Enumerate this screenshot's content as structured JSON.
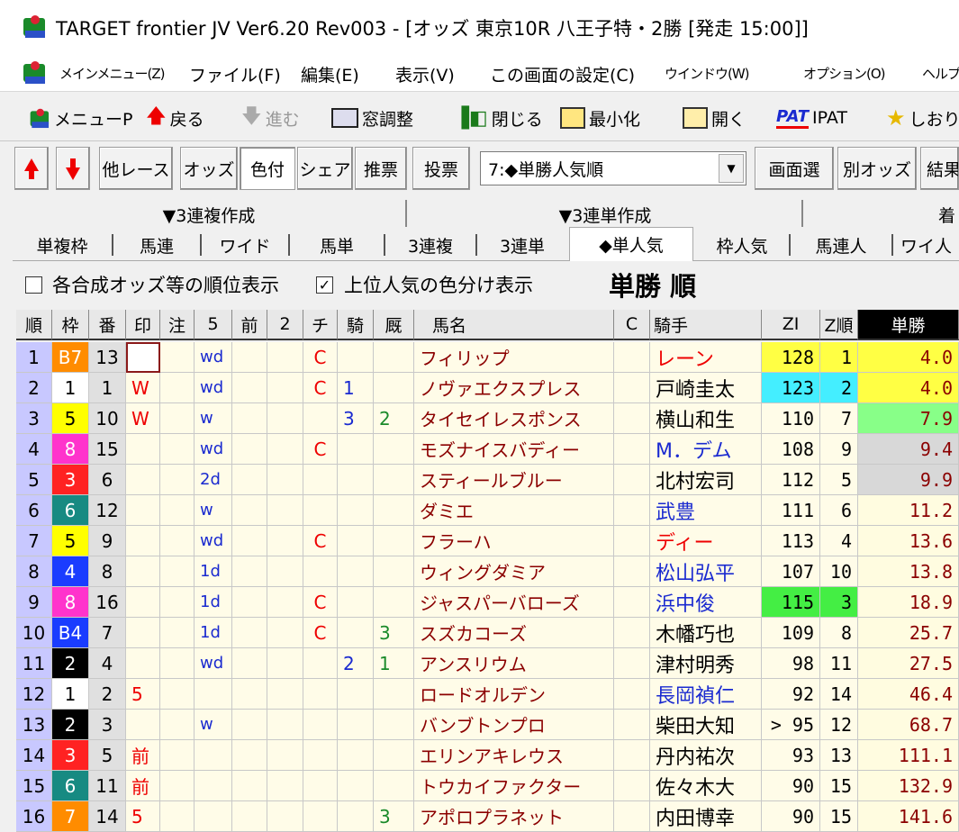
{
  "window": {
    "title": "TARGET frontier JV  Ver6.20  Rev003 - [オッズ 東京10R 八王子特・2勝  [発走 15:00]]"
  },
  "menu": {
    "main": "メインメニュー(Z)",
    "file": "ファイル(F)",
    "edit": "編集(E)",
    "view": "表示(V)",
    "screen_settings": "この画面の設定(C)",
    "window": "ウインドウ(W)",
    "option": "オプション(O)",
    "help": "ヘルプ"
  },
  "toolbar": {
    "menu_p": "メニューP",
    "back": "戻る",
    "forward": "進む",
    "window_adjust": "窓調整",
    "close": "閉じる",
    "minimize": "最小化",
    "open": "開く",
    "ipat_icon": "PAT",
    "ipat": "IPAT",
    "bookmark": "しおり"
  },
  "toolbar2": {
    "other_race": "他レース",
    "odds": "オッズ",
    "color": "色付",
    "share": "シェア",
    "recommend": "推票",
    "vote": "投票",
    "select_value": "7:◆単勝人気順",
    "screen_select": "画面選",
    "other_odds": "別オッズ",
    "result": "結果"
  },
  "tab_groups": {
    "trio_make": "▼3連複作成",
    "trifecta_make": "▼3連単作成",
    "extra": "着"
  },
  "tabs": [
    "単複枠",
    "馬連",
    "ワイド",
    "馬単",
    "3連複",
    "3連単",
    "◆単人気",
    "枠人気",
    "馬連人",
    "ワイ人"
  ],
  "options": {
    "rank_display": "各合成オッズ等の順位表示",
    "rank_display_checked": false,
    "color_display": "上位人気の色分け表示",
    "color_display_checked": true,
    "check_mark": "✓"
  },
  "view_title": "単勝 順",
  "columns": [
    "順",
    "枠",
    "番",
    "印",
    "注",
    "5",
    "前",
    "2",
    "チ",
    "騎",
    "厩",
    "馬名",
    "C",
    "騎手",
    "ZI",
    "Z順",
    "単勝"
  ],
  "colors": {
    "gate1": "#ffffff",
    "gate2": "#000000",
    "gate3": "#ff2222",
    "gate4": "#1a3cff",
    "gate5": "#ffff00",
    "gate6": "#178a82",
    "gate7": "#ff8c00",
    "gate8": "#ff33cc",
    "rank_bg": "#c8c8ff",
    "yellow": "#ffff44",
    "cyan": "#44eeff",
    "green": "#44ee44",
    "odds_green": "#88ff88",
    "odds_gray": "#d8d8d8",
    "odds_bg": "#fffce0",
    "row_bg": "#fffce8"
  },
  "rows": [
    {
      "rank": "1",
      "gate": "B7",
      "num": "13",
      "mark": "",
      "note": "",
      "five": "wd",
      "mae": "",
      "two": "",
      "chi": "C",
      "ki": "",
      "kyu": "",
      "name": "フィリップ",
      "c": "",
      "jockey": "レーン",
      "jockey_color": "red",
      "zi": "128",
      "zi_bg": "yellow",
      "zrank": "1",
      "zrank_bg": "yellow",
      "odds": "4.0",
      "odds_bg": "yellow",
      "gatecolor": "7",
      "gate_box": true
    },
    {
      "rank": "2",
      "gate": "1",
      "num": "1",
      "mark": "W",
      "note": "",
      "five": "wd",
      "mae": "",
      "two": "",
      "chi": "C",
      "ki": "1",
      "kyu": "",
      "name": "ノヴァエクスプレス",
      "c": "",
      "jockey": "戸崎圭太",
      "jockey_color": "black",
      "zi": "123",
      "zi_bg": "cyan",
      "zrank": "2",
      "zrank_bg": "cyan",
      "odds": "4.0",
      "odds_bg": "yellow",
      "gatecolor": "1"
    },
    {
      "rank": "3",
      "gate": "5",
      "num": "10",
      "mark": "W",
      "note": "",
      "five": "w",
      "mae": "",
      "two": "",
      "chi": "",
      "ki": "3",
      "kyu": "2",
      "name": "タイセイレスポンス",
      "c": "",
      "jockey": "横山和生",
      "jockey_color": "black",
      "zi": "110",
      "zi_bg": "",
      "zrank": "7",
      "zrank_bg": "",
      "odds": "7.9",
      "odds_bg": "green",
      "gatecolor": "5"
    },
    {
      "rank": "4",
      "gate": "8",
      "num": "15",
      "mark": "",
      "note": "",
      "five": "wd",
      "mae": "",
      "two": "",
      "chi": "C",
      "ki": "",
      "kyu": "",
      "name": "モズナイスバディー",
      "c": "",
      "jockey": "M．デム",
      "jockey_color": "blue",
      "zi": "108",
      "zi_bg": "",
      "zrank": "9",
      "zrank_bg": "",
      "odds": "9.4",
      "odds_bg": "gray",
      "gatecolor": "8"
    },
    {
      "rank": "5",
      "gate": "3",
      "num": "6",
      "mark": "",
      "note": "",
      "five": "2d",
      "mae": "",
      "two": "",
      "chi": "",
      "ki": "",
      "kyu": "",
      "name": "スティールブルー",
      "c": "",
      "jockey": "北村宏司",
      "jockey_color": "black",
      "zi": "112",
      "zi_bg": "",
      "zrank": "5",
      "zrank_bg": "",
      "odds": "9.9",
      "odds_bg": "gray",
      "gatecolor": "3"
    },
    {
      "rank": "6",
      "gate": "6",
      "num": "12",
      "mark": "",
      "note": "",
      "five": "w",
      "mae": "",
      "two": "",
      "chi": "",
      "ki": "",
      "kyu": "",
      "name": "ダミエ",
      "c": "",
      "jockey": "武豊",
      "jockey_color": "blue",
      "zi": "111",
      "zi_bg": "",
      "zrank": "6",
      "zrank_bg": "",
      "odds": "11.2",
      "odds_bg": "",
      "gatecolor": "6"
    },
    {
      "rank": "7",
      "gate": "5",
      "num": "9",
      "mark": "",
      "note": "",
      "five": "wd",
      "mae": "",
      "two": "",
      "chi": "C",
      "ki": "",
      "kyu": "",
      "name": "フラーハ",
      "c": "",
      "jockey": "ディー",
      "jockey_color": "red",
      "zi": "113",
      "zi_bg": "",
      "zrank": "4",
      "zrank_bg": "",
      "odds": "13.6",
      "odds_bg": "",
      "gatecolor": "5"
    },
    {
      "rank": "8",
      "gate": "4",
      "num": "8",
      "mark": "",
      "note": "",
      "five": "1d",
      "mae": "",
      "two": "",
      "chi": "",
      "ki": "",
      "kyu": "",
      "name": "ウィングダミア",
      "c": "",
      "jockey": "松山弘平",
      "jockey_color": "blue",
      "zi": "107",
      "zi_bg": "",
      "zrank": "10",
      "zrank_bg": "",
      "odds": "13.8",
      "odds_bg": "",
      "gatecolor": "4"
    },
    {
      "rank": "9",
      "gate": "8",
      "num": "16",
      "mark": "",
      "note": "",
      "five": "1d",
      "mae": "",
      "two": "",
      "chi": "C",
      "ki": "",
      "kyu": "",
      "name": "ジャスパーバローズ",
      "c": "",
      "jockey": "浜中俊",
      "jockey_color": "blue",
      "zi": "115",
      "zi_bg": "green",
      "zrank": "3",
      "zrank_bg": "green",
      "odds": "18.9",
      "odds_bg": "",
      "gatecolor": "8"
    },
    {
      "rank": "10",
      "gate": "B4",
      "num": "7",
      "mark": "",
      "note": "",
      "five": "1d",
      "mae": "",
      "two": "",
      "chi": "C",
      "ki": "",
      "kyu": "3",
      "name": "スズカコーズ",
      "c": "",
      "jockey": "木幡巧也",
      "jockey_color": "black",
      "zi": "109",
      "zi_bg": "",
      "zrank": "8",
      "zrank_bg": "",
      "odds": "25.7",
      "odds_bg": "",
      "gatecolor": "4"
    },
    {
      "rank": "11",
      "gate": "2",
      "num": "4",
      "mark": "",
      "note": "",
      "five": "wd",
      "mae": "",
      "two": "",
      "chi": "",
      "ki": "2",
      "kyu": "1",
      "name": "アンスリウム",
      "c": "",
      "jockey": "津村明秀",
      "jockey_color": "black",
      "zi": "98",
      "zi_bg": "",
      "zrank": "11",
      "zrank_bg": "",
      "odds": "27.5",
      "odds_bg": "",
      "gatecolor": "2"
    },
    {
      "rank": "12",
      "gate": "1",
      "num": "2",
      "mark": "5",
      "note": "",
      "five": "",
      "mae": "",
      "two": "",
      "chi": "",
      "ki": "",
      "kyu": "",
      "name": "ロードオルデン",
      "c": "",
      "jockey": "長岡禎仁",
      "jockey_color": "blue",
      "zi": "92",
      "zi_bg": "",
      "zrank": "14",
      "zrank_bg": "",
      "odds": "46.4",
      "odds_bg": "",
      "gatecolor": "1"
    },
    {
      "rank": "13",
      "gate": "2",
      "num": "3",
      "mark": "",
      "note": "",
      "five": "w",
      "mae": "",
      "two": "",
      "chi": "",
      "ki": "",
      "kyu": "",
      "name": "バンブトンプロ",
      "c": "",
      "jockey": "柴田大知",
      "jockey_color": "black",
      "zi": "> 95",
      "zi_bg": "",
      "zrank": "12",
      "zrank_bg": "",
      "odds": "68.7",
      "odds_bg": "",
      "gatecolor": "2"
    },
    {
      "rank": "14",
      "gate": "3",
      "num": "5",
      "mark": "前",
      "note": "",
      "five": "",
      "mae": "",
      "two": "",
      "chi": "",
      "ki": "",
      "kyu": "",
      "name": "エリンアキレウス",
      "c": "",
      "jockey": "丹内祐次",
      "jockey_color": "black",
      "zi": "93",
      "zi_bg": "",
      "zrank": "13",
      "zrank_bg": "",
      "odds": "111.1",
      "odds_bg": "",
      "gatecolor": "3"
    },
    {
      "rank": "15",
      "gate": "6",
      "num": "11",
      "mark": "前",
      "note": "",
      "five": "",
      "mae": "",
      "two": "",
      "chi": "",
      "ki": "",
      "kyu": "",
      "name": "トウカイファクター",
      "c": "",
      "jockey": "佐々木大",
      "jockey_color": "black",
      "zi": "90",
      "zi_bg": "",
      "zrank": "15",
      "zrank_bg": "",
      "odds": "132.9",
      "odds_bg": "",
      "gatecolor": "6"
    },
    {
      "rank": "16",
      "gate": "7",
      "num": "14",
      "mark": "5",
      "note": "",
      "five": "",
      "mae": "",
      "two": "",
      "chi": "",
      "ki": "",
      "kyu": "3",
      "name": "アポロプラネット",
      "c": "",
      "jockey": "内田博幸",
      "jockey_color": "black",
      "zi": "90",
      "zi_bg": "",
      "zrank": "15",
      "zrank_bg": "",
      "odds": "141.6",
      "odds_bg": "",
      "gatecolor": "7"
    }
  ]
}
